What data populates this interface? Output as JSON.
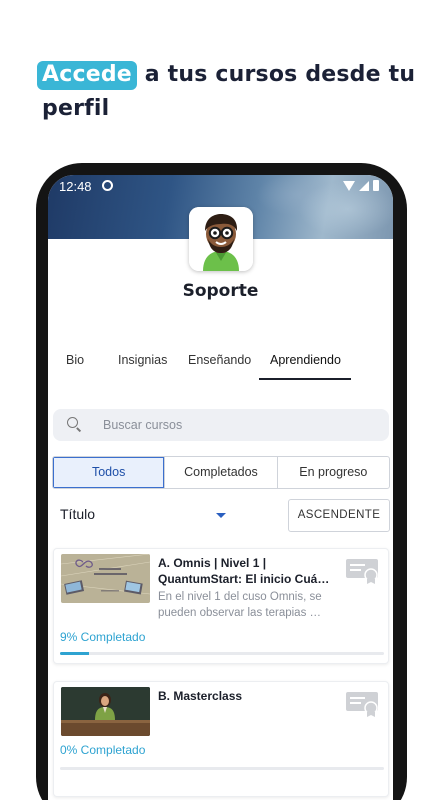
{
  "headline": {
    "highlight": "Accede",
    "line1_rest": "a tus cursos desde tu",
    "line2": "perfil"
  },
  "status_bar": {
    "time": "12:48"
  },
  "profile": {
    "name": "Soporte"
  },
  "tabs": [
    {
      "label": "Bio",
      "active": false
    },
    {
      "label": "Insignias",
      "active": false
    },
    {
      "label": "Enseñando",
      "active": false
    },
    {
      "label": "Aprendiendo",
      "active": true
    }
  ],
  "search": {
    "placeholder": "Buscar cursos",
    "value": ""
  },
  "filters": [
    {
      "label": "Todos",
      "selected": true
    },
    {
      "label": "Completados",
      "selected": false
    },
    {
      "label": "En progreso",
      "selected": false
    }
  ],
  "sort": {
    "field": "Título",
    "order_button": "ASCENDENTE"
  },
  "courses": [
    {
      "title_line1": "A. Omnis  | Nivel 1 |",
      "title_line2": "QuantumStart: El inicio Cuá…",
      "desc_line1": "En el nivel 1 del cuso Omnis, se",
      "desc_line2": "pueden observar las terapias …",
      "progress_text": "9% Completado",
      "progress": 0.09
    },
    {
      "title_line1": "B. Masterclass",
      "title_line2": "",
      "desc_line1": "",
      "desc_line2": "",
      "progress_text": "0% Completado",
      "progress": 0.0
    }
  ],
  "colors": {
    "accent": "#3ab6d6",
    "progress": "#2ea3d1",
    "selected_filter": "#3b6fce"
  },
  "icons": [
    "search-icon",
    "certificate-icon",
    "dropdown-caret-icon",
    "wifi-icon",
    "signal-icon",
    "battery-icon"
  ]
}
